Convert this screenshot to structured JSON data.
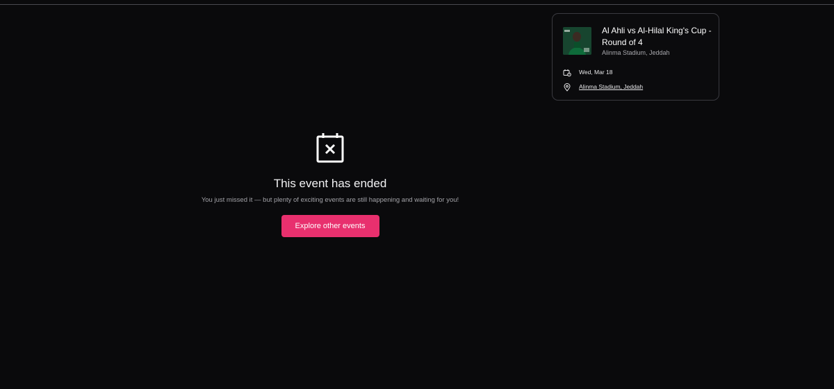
{
  "event_card": {
    "title": "Al Ahli vs Al-Hilal King's Cup - Round of 4",
    "subtitle": "Alinma Stadium, Jeddah",
    "date": "Wed, Mar 18",
    "venue_link": "Alinma Stadium, Jeddah",
    "thumbnail_icon": "event-photo"
  },
  "ended": {
    "icon": "calendar-x-icon",
    "title": "This event has ended",
    "subtitle": "You just missed it — but plenty of exciting events are still happening and waiting for you!",
    "button_label": "Explore other events"
  },
  "colors": {
    "background": "#0a0a0c",
    "accent": "#e8306e",
    "card_border": "#3a3a40"
  }
}
